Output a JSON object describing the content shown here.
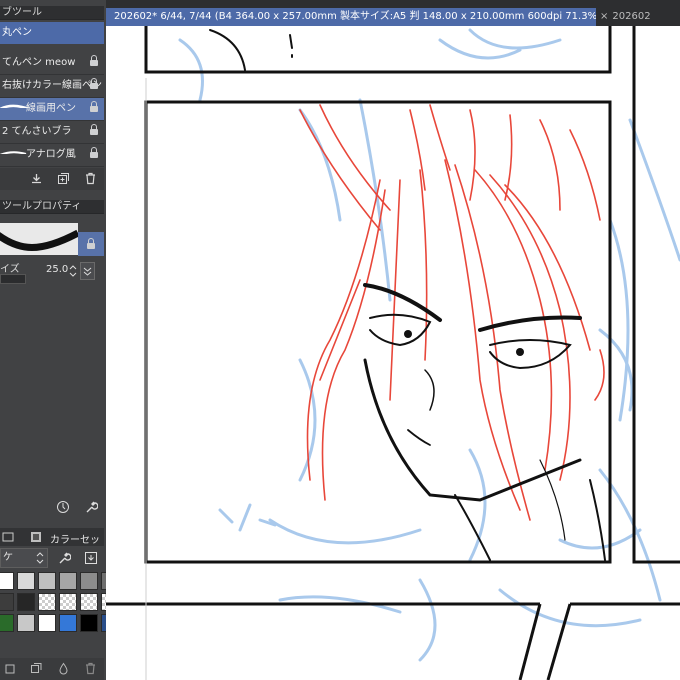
{
  "sub_tool_panel": {
    "header": "ブツール",
    "selected_tool": "丸ペン",
    "brushes": [
      {
        "label": "てんペン meow"
      },
      {
        "label": "右抜けカラー線画ペン"
      },
      {
        "label": "線画用ペン"
      },
      {
        "label": "2 てんさいブラ"
      },
      {
        "label": "アナログ風"
      }
    ]
  },
  "tool_property": {
    "header": "ツールプロパティ",
    "size_label": "イズ",
    "size_value": "25.0"
  },
  "color_set": {
    "tab_label": "カラーセッ",
    "dropdown_value": "ケ",
    "colors": [
      "#ffffff",
      "#d9d9d9",
      "#bfbfbf",
      "#a6a6a6",
      "#8c8c8c",
      "#6e6e6e",
      "#595959",
      "#3d3d3d",
      "#262626",
      "#111111",
      "#000000",
      "#2a6b2a",
      "#c8c8c8",
      "#ffffff",
      "#3478d8",
      "#2a4e8a"
    ]
  },
  "document": {
    "active_tab": "202602* 6/44, 7/44 (B4 364.00 x 257.00mm 製本サイズ:A5 判 148.00 x 210.00mm 600dpi 71.3%)",
    "inactive_tab": "202602"
  },
  "colors": {
    "panel_bg": "#414244",
    "selection": "#4d6aa8",
    "sketch_blue": "#a9c9ec",
    "hair_red": "#e8473a",
    "ink": "#111111"
  }
}
